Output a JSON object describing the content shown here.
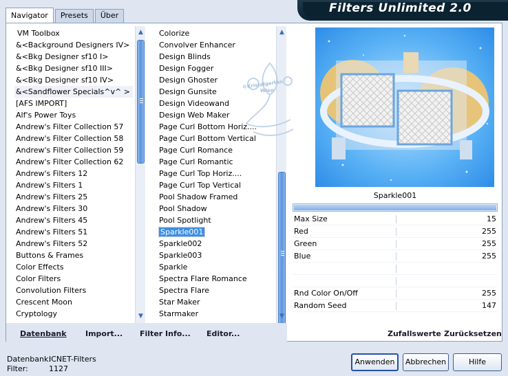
{
  "banner": {
    "title": "Filters Unlimited 2.0"
  },
  "tabs": [
    "Navigator",
    "Presets",
    "Über"
  ],
  "categories": [
    "VM Toolbox",
    "&<Background Designers IV>",
    "&<Bkg Designer sf10 I>",
    "&<Bkg Designer sf10 III>",
    "&<Bkg Designer sf10 IV>",
    "&<Sandflower Specials^v^ >",
    "[AFS IMPORT]",
    "Alf's Power Toys",
    "Andrew's Filter Collection 57",
    "Andrew's Filter Collection 58",
    "Andrew's Filter Collection 59",
    "Andrew's Filter Collection 62",
    "Andrew's Filters 12",
    "Andrew's Filters 1",
    "Andrew's Filters 25",
    "Andrew's Filters 30",
    "Andrew's Filters 45",
    "Andrew's Filters 51",
    "Andrew's Filters 52",
    "Buttons & Frames",
    "Color Effects",
    "Color Filters",
    "Convolution Filters",
    "Crescent Moon",
    "Cryptology"
  ],
  "filters": [
    "Colorize",
    "Convolver Enhancer",
    "Design Blinds",
    "Design Fogger",
    "Design Ghoster",
    "Design Gunsite",
    "Design Videowand",
    "Design Web Maker",
    "Page Curl Bottom Horiz....",
    "Page Curl Bottom Vertical",
    "Page Curl Romance",
    "Page Curl Romantic",
    "Page Curl Top Horiz....",
    "Page Curl Top Vertical",
    "Pool Shadow Framed",
    "Pool Shadow",
    "Pool Spotlight",
    "Sparkle001",
    "Sparkle002",
    "Sparkle003",
    "Sparkle",
    "Spectra Flare Romance",
    "Spectra Flare",
    "Star Maker",
    "Starmaker"
  ],
  "watermark": "©Kristalgarten Wien",
  "bottom_links": {
    "datenbank": "Datenbank",
    "import": "Import...",
    "filter_info": "Filter Info...",
    "editor": "Editor..."
  },
  "params": {
    "filter_name": "Sparkle001",
    "rows": [
      {
        "label": "Max Size",
        "value": "15"
      },
      {
        "label": "Red",
        "value": "255"
      },
      {
        "label": "Green",
        "value": "255"
      },
      {
        "label": "Blue",
        "value": "255"
      },
      {
        "label": "",
        "value": ""
      },
      {
        "label": "",
        "value": ""
      },
      {
        "label": "Rnd Color On/Off",
        "value": "255"
      },
      {
        "label": "Random Seed",
        "value": "147"
      }
    ]
  },
  "right_links": {
    "random": "Zufallswerte",
    "reset": "Zurücksetzen"
  },
  "status": {
    "db_label": "Datenbank:",
    "db_value": "ICNET-Filters",
    "filter_label": "Filter:",
    "filter_value": "1127"
  },
  "buttons": {
    "apply": "Anwenden",
    "cancel": "Abbrechen",
    "help": "Hilfe"
  },
  "colors": {
    "selection": "#3d8ee4",
    "preview_bg": "#3fa3f2",
    "banner_bg": "#0b2230"
  }
}
